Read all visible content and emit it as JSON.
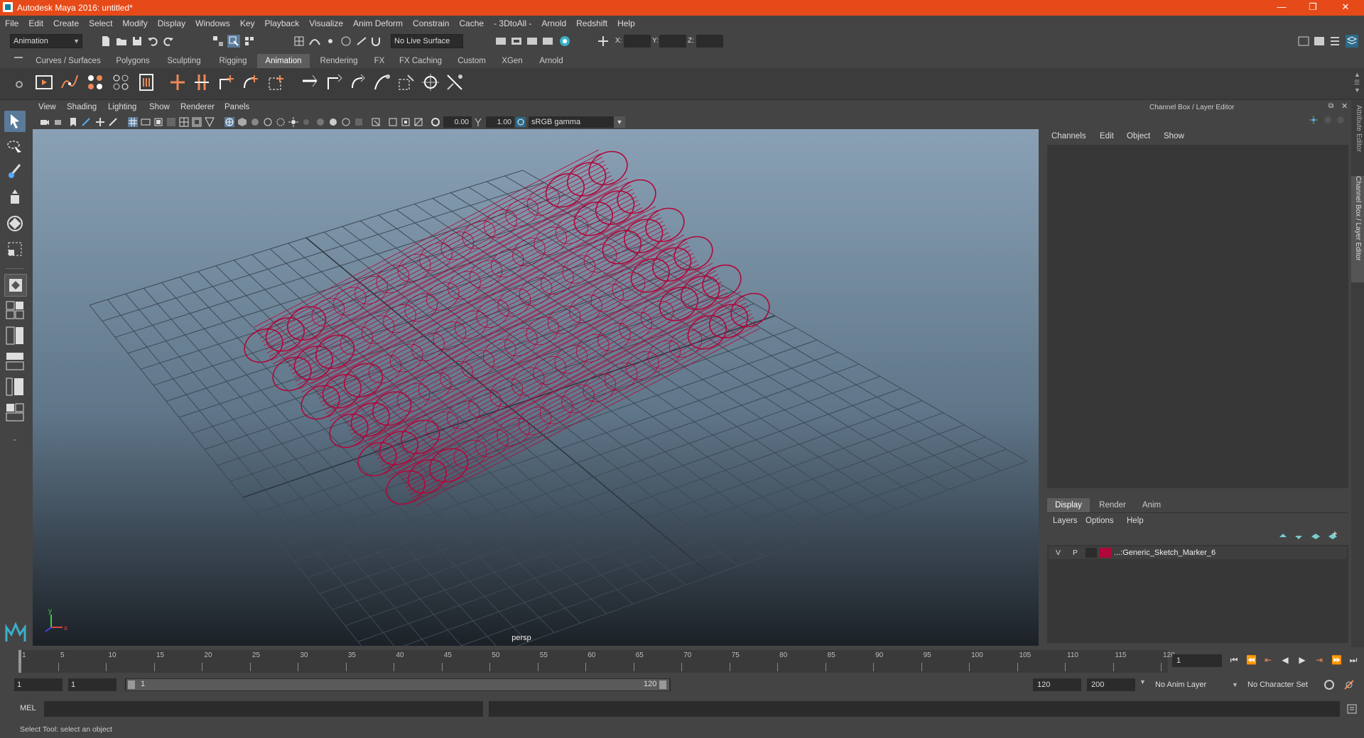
{
  "window": {
    "title": "Autodesk Maya 2016: untitled*",
    "controls": [
      "—",
      "❐",
      "✕"
    ]
  },
  "menu": [
    "File",
    "Edit",
    "Create",
    "Select",
    "Modify",
    "Display",
    "Windows",
    "Key",
    "Playback",
    "Visualize",
    "Anim Deform",
    "Constrain",
    "Cache",
    "- 3DtoAll -",
    "Arnold",
    "Redshift",
    "Help"
  ],
  "status": {
    "mode": "Animation",
    "live_surface": "No Live Surface",
    "x_label": "X:",
    "y_label": "Y:",
    "z_label": "Z:"
  },
  "shelf_tabs": [
    "Curves / Surfaces",
    "Polygons",
    "Sculpting",
    "Rigging",
    "Animation",
    "Rendering",
    "FX",
    "FX Caching",
    "Custom",
    "XGen",
    "Arnold"
  ],
  "active_shelf_tab": "Animation",
  "panel_menu": [
    "View",
    "Shading",
    "Lighting",
    "Show",
    "Renderer",
    "Panels"
  ],
  "panel_bar": {
    "exposure": "0.00",
    "gamma": "1.00",
    "color_space": "sRGB gamma"
  },
  "viewport": {
    "camera_label": "persp",
    "axis_y": "y",
    "axis_x": "x",
    "wire_color": "#b0083a"
  },
  "channel_box": {
    "title": "Channel Box / Layer Editor",
    "menus": [
      "Channels",
      "Edit",
      "Object",
      "Show"
    ]
  },
  "layer_editor": {
    "tabs": [
      "Display",
      "Render",
      "Anim"
    ],
    "active_tab": "Display",
    "menus": [
      "Layers",
      "Options",
      "Help"
    ],
    "layer": {
      "v": "V",
      "p": "P",
      "name": "...:Generic_Sketch_Marker_6",
      "color": "#b0083a"
    }
  },
  "side_tabs": [
    "Attribute Editor",
    "Channel Box / Layer Editor"
  ],
  "timeline": {
    "ticks": [
      1,
      5,
      10,
      15,
      20,
      25,
      30,
      35,
      40,
      45,
      50,
      55,
      60,
      65,
      70,
      75,
      80,
      85,
      90,
      95,
      100,
      105,
      110,
      115,
      120
    ],
    "current_frame": "1"
  },
  "range": {
    "start": "1",
    "inner_start": "1",
    "slider_start": "1",
    "slider_end": "120",
    "end": "120",
    "max": "200",
    "anim_layer": "No Anim Layer",
    "char_set": "No Character Set"
  },
  "command": {
    "label": "MEL"
  },
  "help_line": "Select Tool: select an object"
}
